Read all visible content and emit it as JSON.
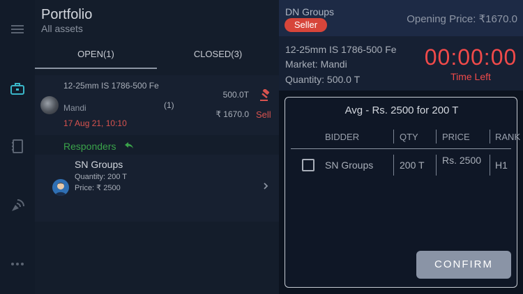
{
  "nav": {
    "items": [
      {
        "icon": "menu-icon"
      },
      {
        "icon": "briefcase-icon",
        "active": true
      },
      {
        "icon": "notebook-icon"
      },
      {
        "icon": "satellite-dish-icon"
      },
      {
        "icon": "more-icon"
      }
    ],
    "active_color": "#3ab7c9"
  },
  "portfolio": {
    "title": "Portfolio",
    "subtitle": "All assets",
    "tabs": [
      {
        "label": "OPEN(1)",
        "active": true
      },
      {
        "label": "CLOSED(3)",
        "active": false
      }
    ],
    "listing": {
      "name": "12-25mm IS 1786-500 Fe",
      "market": "Mandi",
      "date": "17 Aug 21, 10:10",
      "count": "(1)",
      "quantity": "500.0T",
      "price": "₹ 1670.0",
      "type": "Sell"
    },
    "responders_label": "Responders",
    "responder": {
      "name": "SN Groups",
      "quantity": "Quantity:  200 T",
      "price": "Price: ₹ 2500"
    }
  },
  "detail": {
    "seller_name": "DN Groups",
    "badge": "Seller",
    "opening_price": "Opening Price: ₹1670.0",
    "product": "12-25mm IS 1786-500 Fe",
    "market": "Market: Mandi",
    "quantity": "Quantity: 500.0 T",
    "timer": "00:00:00",
    "timer_label": "Time Left",
    "avg": "Avg - Rs. 2500 for 200 T",
    "columns": [
      "BIDDER",
      "QTY",
      "PRICE",
      "RANK"
    ],
    "rows": [
      {
        "bidder": "SN Groups",
        "qty": "200 T",
        "price": "Rs. 2500",
        "rank": "H1",
        "checked": false
      }
    ],
    "confirm_label": "CONFIRM"
  },
  "colors": {
    "danger": "#f04a4a",
    "success": "#3aa34a",
    "badge": "#d7453a",
    "button": "#8a94a6"
  }
}
